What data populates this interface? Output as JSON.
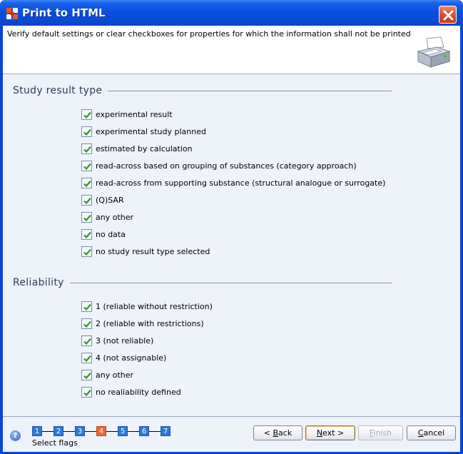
{
  "window": {
    "title": "Print to HTML"
  },
  "header": {
    "instruction": "Verify default settings or clear checkboxes for properties for which the information shall not be printed"
  },
  "sections": [
    {
      "title": "Study result type",
      "items": [
        {
          "label": "experimental result",
          "checked": true
        },
        {
          "label": "experimental study planned",
          "checked": true
        },
        {
          "label": "estimated by calculation",
          "checked": true
        },
        {
          "label": "read-across based on grouping of substances (category approach)",
          "checked": true
        },
        {
          "label": "read-across from supporting substance (structural analogue or surrogate)",
          "checked": true
        },
        {
          "label": "(Q)SAR",
          "checked": true
        },
        {
          "label": "any other",
          "checked": true
        },
        {
          "label": "no data",
          "checked": true
        },
        {
          "label": "no study result type selected",
          "checked": true
        }
      ]
    },
    {
      "title": "Reliability",
      "items": [
        {
          "label": "1 (reliable without restriction)",
          "checked": true
        },
        {
          "label": "2 (reliable with restrictions)",
          "checked": true
        },
        {
          "label": "3 (not reliable)",
          "checked": true
        },
        {
          "label": "4 (not assignable)",
          "checked": true
        },
        {
          "label": "any other",
          "checked": true
        },
        {
          "label": "no realiability defined",
          "checked": true
        }
      ]
    }
  ],
  "wizard": {
    "steps": [
      "1",
      "2",
      "3",
      "4",
      "5",
      "6",
      "7"
    ],
    "current_step": 4,
    "step_label": "Select flags"
  },
  "buttons": {
    "back": {
      "prefix": "< ",
      "mnemonic": "B",
      "rest": "ack"
    },
    "next": {
      "mnemonic": "N",
      "rest": "ext >"
    },
    "finish": {
      "mnemonic": "F",
      "rest": "inish"
    },
    "cancel": {
      "mnemonic": "C",
      "rest": "ancel"
    }
  },
  "colors": {
    "title_bar": "#0a49d4",
    "close_button": "#e0512e",
    "step": "#2a7ad8",
    "step_active": "#f0662a",
    "check": "#2c9a2c"
  },
  "icons": {
    "window": "app-logo-icon",
    "close": "close-icon",
    "printer": "printer-icon",
    "help": "help-icon",
    "check": "checkmark-icon"
  }
}
